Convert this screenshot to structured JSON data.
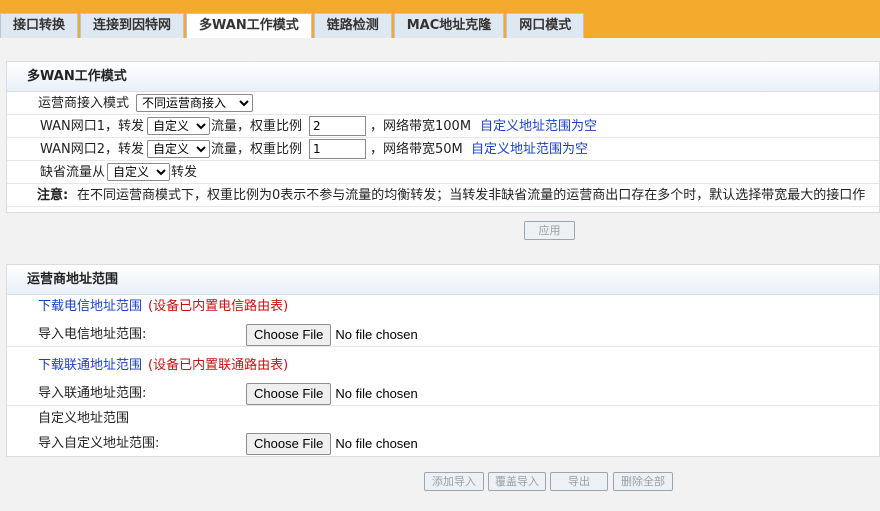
{
  "tabs": [
    "接口转换",
    "连接到因特网",
    "多WAN工作模式",
    "链路检测",
    "MAC地址克隆",
    "网口模式"
  ],
  "active_tab": 2,
  "section1": {
    "title": "多WAN工作模式",
    "mode_label": "运营商接入模式",
    "mode_value": "不同运营商接入",
    "wan1": {
      "prefix": "WAN网口1，转发",
      "select": "自定义",
      "mid": "流量，权重比例",
      "weight": "2",
      "bandwidth": "，网络带宽100M",
      "link": "自定义地址范围为空"
    },
    "wan2": {
      "prefix": "WAN网口2，转发",
      "select": "自定义",
      "mid": "流量，权重比例",
      "weight": "1",
      "bandwidth": "，网络带宽50M",
      "link": "自定义地址范围为空"
    },
    "default_prefix": "缺省流量从",
    "default_select": "自定义",
    "default_suffix": "转发",
    "note_label": "注意:",
    "note_text": "在不同运营商模式下，权重比例为0表示不参与流量的均衡转发；当转发非缺省流量的运营商出口存在多个时，默认选择带宽最大的接口作",
    "apply": "应用"
  },
  "section2": {
    "title": "运营商地址范围",
    "telecom_link": "下载电信地址范围",
    "telecom_note": "(设备已内置电信路由表)",
    "telecom_import": "导入电信地址范围:",
    "unicom_link": "下载联通地址范围",
    "unicom_note": "(设备已内置联通路由表)",
    "unicom_import": "导入联通地址范围:",
    "custom_title": "自定义地址范围",
    "custom_import": "导入自定义地址范围:",
    "choose_file": "Choose File",
    "no_file": "No file chosen"
  },
  "actions": [
    "添加导入",
    "覆盖导入",
    "导出",
    "删除全部"
  ]
}
